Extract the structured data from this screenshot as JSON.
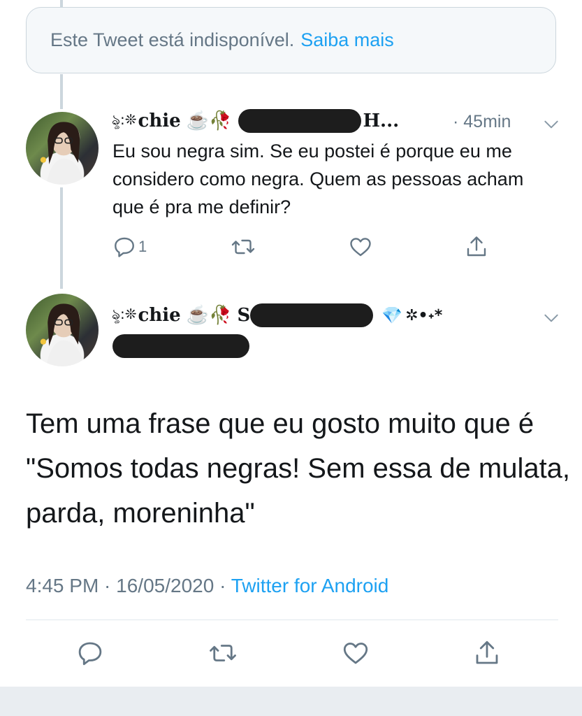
{
  "unavailable": {
    "message": "Este Tweet está indisponível.",
    "link": "Saiba mais"
  },
  "reply_tweet": {
    "name_prefix": "ৡ:❊",
    "display_name": "chie",
    "name_emoji": "☕️🥀",
    "name_trail": "H...",
    "time": "· 45min",
    "text": "Eu sou negra sim. Se eu postei é porque eu me considero como negra. Quem as pessoas acham que é pra me definir?",
    "reply_count": "1"
  },
  "main_tweet": {
    "name_prefix": "ৡ:❊",
    "display_name": "chie",
    "name_emoji": "☕️🥀",
    "name_trail": "S",
    "name_suffix_gem": "💎",
    "name_suffix_sparkle": "✲•˖*",
    "text": "Tem uma frase que eu gosto muito que é \"Somos todas negras! Sem essa de mulata, parda, moreninha\"",
    "timestamp": "4:45 PM · 16/05/2020 ·",
    "source": "Twitter for Android"
  },
  "icons": {
    "reply": "reply-icon",
    "retweet": "retweet-icon",
    "like": "like-icon",
    "share": "share-icon",
    "more": "chevron-down-icon"
  },
  "colors": {
    "accent": "#1da1f2",
    "muted": "#657786",
    "text": "#14171a",
    "border": "#ccd6dd"
  }
}
